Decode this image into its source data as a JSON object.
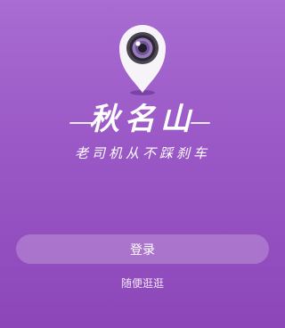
{
  "app": {
    "title": "秋名山",
    "slogan": "老司机从不踩刹车"
  },
  "actions": {
    "login_label": "登录",
    "browse_label": "随便逛逛"
  },
  "icons": {
    "logo": "camera-lens-location-pin-icon"
  },
  "colors": {
    "background_top": "#a86cd2",
    "background_bottom": "#8c46b8",
    "text": "#ffffff"
  }
}
